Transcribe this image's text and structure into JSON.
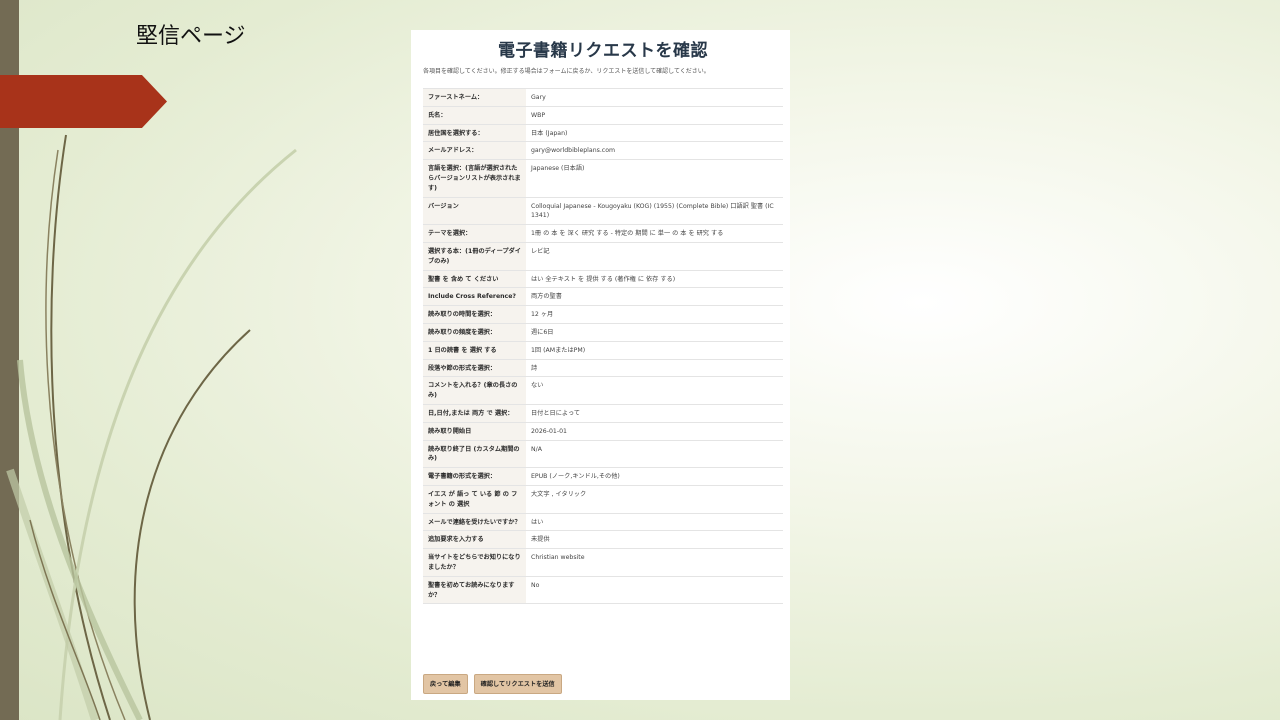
{
  "slide": {
    "title": "堅信ページ"
  },
  "card": {
    "title": "電子書籍リクエストを確認",
    "subtitle": "各項目を確認してください。修正する場合はフォームに戻るか、リクエストを送信して確認してください。"
  },
  "rows": [
    {
      "label": "ファーストネーム：",
      "value": "Gary"
    },
    {
      "label": "氏名：",
      "value": "WBP"
    },
    {
      "label": "居住国を選択する：",
      "value": "日本 (Japan)"
    },
    {
      "label": "メールアドレス：",
      "value": "gary@worldbibleplans.com"
    },
    {
      "label": "言語を選択：(言語が選択されたらバージョンリストが表示されます)",
      "value": "Japanese (日本語)"
    },
    {
      "label": "バージョン",
      "value": "Colloquial Japanese - Kougoyaku (KOG) (1955) (Complete Bible) 口語訳 聖書 (IC 1341)"
    },
    {
      "label": "テーマを選択：",
      "value": "1冊 の 本 を 深く 研究 する - 特定の 期間 に 単一 の 本 を 研究 する"
    },
    {
      "label": "選択する本：(1冊のディープダイブのみ)",
      "value": "レビ記"
    },
    {
      "label": "聖書 を 含め て ください",
      "value": "はい 全テキスト を 提供 する (著作権 に 依存 する)"
    },
    {
      "label": "Include Cross Reference?",
      "value": "両方の聖書"
    },
    {
      "label": "読み取りの時間を選択：",
      "value": "12 ヶ月"
    },
    {
      "label": "読み取りの頻度を選択：",
      "value": "週に6日"
    },
    {
      "label": "1 日の読書 を 選択 する",
      "value": "1回 (AMまたはPM)"
    },
    {
      "label": "段落や節の形式を選択：",
      "value": "詩"
    },
    {
      "label": "コメントを入れる？(章の長さのみ)",
      "value": "ない"
    },
    {
      "label": "日,日付,または 両方 で 選択：",
      "value": "日付と日によって"
    },
    {
      "label": "読み取り開始日",
      "value": "2026-01-01"
    },
    {
      "label": "読み取り終了日 (カスタム期間のみ)",
      "value": "N/A"
    },
    {
      "label": "電子書籍の形式を選択：",
      "value": "EPUB (ノーク,キンドル,その他)"
    },
    {
      "label": "イエス が 語っ て いる 節 の フォント の 選択",
      "value": "大文字 , イタリック"
    },
    {
      "label": "メールで連絡を受けたいですか？",
      "value": "はい"
    },
    {
      "label": "追加要求を入力する",
      "value": "未提供"
    },
    {
      "label": "当サイトをどちらでお知りになりましたか？",
      "value": "Christian website"
    },
    {
      "label": "聖書を初めてお読みになりますか？",
      "value": "No"
    }
  ],
  "buttons": {
    "back": "戻って編集",
    "submit": "確認してリクエストを送信"
  },
  "colors": {
    "accent_red": "#a8331a",
    "left_bar": "#736b54",
    "button_bg": "#e2c5a4",
    "title_text": "#283849"
  }
}
